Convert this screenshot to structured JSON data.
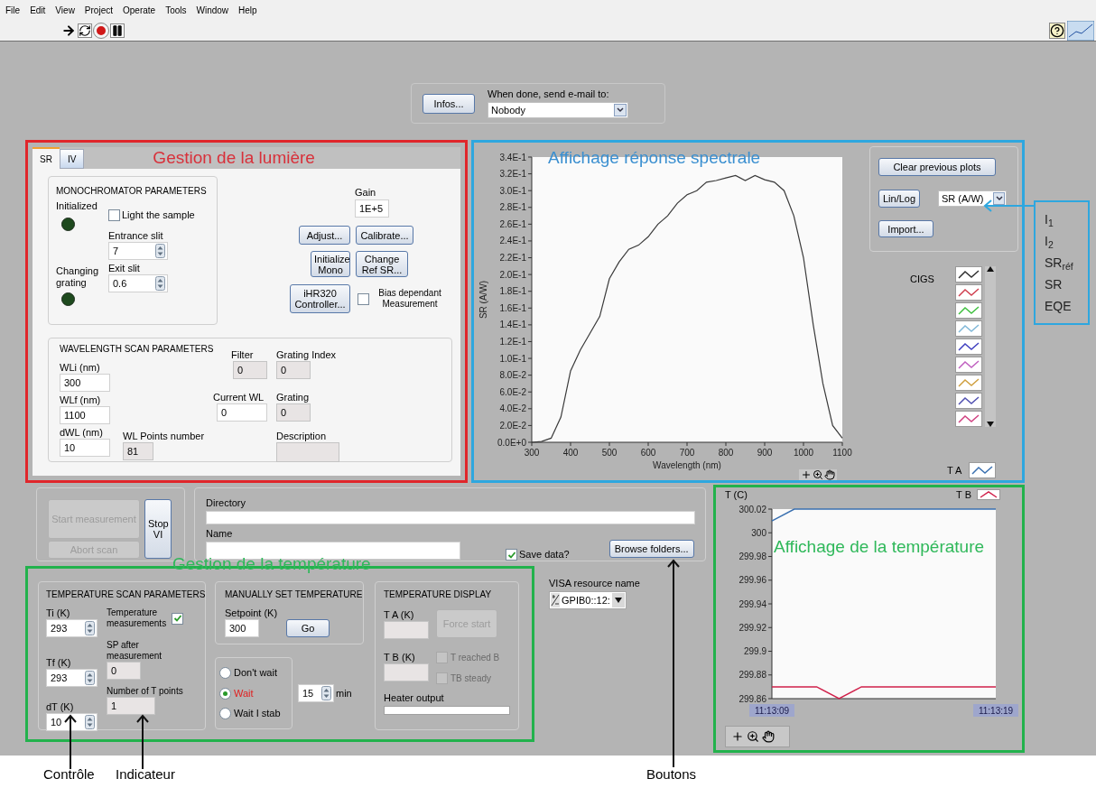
{
  "menu": [
    "File",
    "Edit",
    "View",
    "Project",
    "Operate",
    "Tools",
    "Window",
    "Help"
  ],
  "email": {
    "button": "Infos...",
    "label": "When done, send e-mail to:",
    "value": "Nobody"
  },
  "light": {
    "title": "Gestion de la lumière",
    "tabs": [
      {
        "label": "SR",
        "selected": true
      },
      {
        "label": "IV",
        "selected": false
      }
    ],
    "mono": {
      "title": "MONOCHROMATOR PARAMETERS",
      "initialized": {
        "label": "Initialized",
        "on": false
      },
      "light_sample": {
        "label": "Light the sample",
        "checked": false
      },
      "entrance": {
        "label": "Entrance slit",
        "value": "7"
      },
      "exit": {
        "label": "Exit slit",
        "value": "0.6"
      },
      "changing": {
        "label": "Changing grating",
        "on": false
      }
    },
    "gain": {
      "label": "Gain",
      "value": "1E+5"
    },
    "buttons": [
      "Adjust...",
      "Calibrate...",
      "Initialize Mono",
      "Change Ref SR...",
      "iHR320 Controller..."
    ],
    "bias": {
      "label": "Bias dependant Measurement",
      "checked": false
    },
    "scan": {
      "title": "WAVELENGTH SCAN PARAMETERS",
      "wli": {
        "label": "WLi (nm)",
        "value": "300"
      },
      "wlf": {
        "label": "WLf (nm)",
        "value": "1100"
      },
      "dwl": {
        "label": "dWL (nm)",
        "value": "10"
      },
      "points": {
        "label": "WL Points number",
        "value": "81"
      },
      "filter": {
        "label": "Filter",
        "value": "0"
      },
      "current": {
        "label": "Current WL",
        "value": "0"
      },
      "grating_index": {
        "label": "Grating Index",
        "value": "0"
      },
      "grating": {
        "label": "Grating",
        "value": "0"
      },
      "description": {
        "label": "Description"
      }
    }
  },
  "spectral": {
    "title": "Affichage réponse spectrale",
    "chart_data": {
      "type": "line",
      "xlabel": "Wavelength (nm)",
      "ylabel": "SR (A/W)",
      "xlim": [
        300,
        1100
      ],
      "ylim": [
        0,
        0.34
      ],
      "x": [
        300,
        325,
        350,
        375,
        400,
        425,
        450,
        475,
        500,
        525,
        550,
        575,
        600,
        625,
        650,
        675,
        700,
        725,
        750,
        775,
        800,
        825,
        850,
        875,
        900,
        925,
        950,
        975,
        1000,
        1025,
        1050,
        1075,
        1100
      ],
      "series": [
        {
          "name": "CIGS",
          "color": "#3a3a3a",
          "values": [
            0,
            0.001,
            0.005,
            0.03,
            0.085,
            0.11,
            0.13,
            0.15,
            0.195,
            0.215,
            0.23,
            0.235,
            0.245,
            0.26,
            0.27,
            0.285,
            0.295,
            0.3,
            0.31,
            0.312,
            0.315,
            0.318,
            0.312,
            0.318,
            0.313,
            0.31,
            0.3,
            0.27,
            0.22,
            0.14,
            0.07,
            0.02,
            0.005
          ]
        }
      ],
      "xticks": [
        300,
        400,
        500,
        600,
        700,
        800,
        900,
        1000,
        1100
      ],
      "yticks": [
        {
          "value": 0,
          "label": "0.0E+0"
        },
        {
          "value": 0.02,
          "label": "2.0E-2"
        },
        {
          "value": 0.04,
          "label": "4.0E-2"
        },
        {
          "value": 0.06,
          "label": "6.0E-2"
        },
        {
          "value": 0.08,
          "label": "8.0E-2"
        },
        {
          "value": 0.1,
          "label": "1.0E-1"
        },
        {
          "value": 0.12,
          "label": "1.2E-1"
        },
        {
          "value": 0.14,
          "label": "1.4E-1"
        },
        {
          "value": 0.16,
          "label": "1.6E-1"
        },
        {
          "value": 0.18,
          "label": "1.8E-1"
        },
        {
          "value": 0.2,
          "label": "2.0E-1"
        },
        {
          "value": 0.22,
          "label": "2.2E-1"
        },
        {
          "value": 0.24,
          "label": "2.4E-1"
        },
        {
          "value": 0.26,
          "label": "2.6E-1"
        },
        {
          "value": 0.28,
          "label": "2.8E-1"
        },
        {
          "value": 0.3,
          "label": "3.0E-1"
        },
        {
          "value": 0.32,
          "label": "3.2E-1"
        },
        {
          "value": 0.34,
          "label": "3.4E-1"
        }
      ]
    },
    "buttons": {
      "clear": "Clear previous plots",
      "linlog": "Lin/Log",
      "import": "Import..."
    },
    "unit": "SR (A/W)",
    "legend": {
      "plots": [
        {
          "color": "#303030"
        },
        {
          "color": "#d04050"
        },
        {
          "color": "#40c040"
        },
        {
          "color": "#80b8d8"
        },
        {
          "color": "#4040c0"
        },
        {
          "color": "#c060c0"
        },
        {
          "color": "#d0a040"
        },
        {
          "color": "#5050b0"
        },
        {
          "color": "#d04080"
        }
      ]
    }
  },
  "quantities": [
    "I$_{1}$",
    "I$_{2}$",
    "SR$_{réf}$",
    "SR",
    "EQE"
  ],
  "run": {
    "start": {
      "label": "Start measurement",
      "disabled": true
    },
    "abort": {
      "label": "Abort scan",
      "disabled": true
    },
    "stop": {
      "label": "Stop VI",
      "disabled": false
    }
  },
  "files": {
    "directory": {
      "label": "Directory"
    },
    "name": {
      "label": "Name"
    },
    "save": {
      "label": "Save data?",
      "checked": true
    },
    "browse": "Browse folders..."
  },
  "temperature": {
    "title": "Gestion de la température",
    "scan": {
      "title": "TEMPERATURE SCAN PARAMETERS",
      "ti": {
        "label": "Ti (K)",
        "value": "293"
      },
      "tf": {
        "label": "Tf (K)",
        "value": "293"
      },
      "dt": {
        "label": "dT (K)",
        "value": "10"
      },
      "measure": {
        "label": "Temperature measurements",
        "checked": true
      },
      "sp_after": {
        "label": "SP after measurement",
        "value": "0"
      },
      "points": {
        "label": "Number of T points",
        "value": "1"
      }
    },
    "manual": {
      "title": "MANUALLY SET TEMPERATURE",
      "setpoint": {
        "label": "Setpoint (K)",
        "value": "300"
      },
      "go": "Go"
    },
    "wait": [
      {
        "label": "Don't wait",
        "selected": false
      },
      {
        "label": "Wait",
        "selected": true
      },
      {
        "label": "Wait I stab",
        "selected": false
      }
    ],
    "wait_time": {
      "value": "15",
      "unit": "min"
    },
    "display": {
      "title": "TEMPERATURE DISPLAY",
      "ta": {
        "label": "T A (K)"
      },
      "tb": {
        "label": "T B (K)"
      },
      "force": {
        "label": "Force start",
        "disabled": true
      },
      "reached": {
        "label": "T reached B",
        "checked": false,
        "disabled": true
      },
      "steady": {
        "label": "TB steady",
        "checked": false,
        "disabled": true
      },
      "heater": {
        "label": "Heater output",
        "level": 0
      }
    }
  },
  "visa": {
    "label": "VISA resource name",
    "value": "GPIB0::12:"
  },
  "temp_chart": {
    "title": "Affichage de la température",
    "chart_data": {
      "type": "line",
      "ylabel": "T (C)",
      "categories": [
        "11:13:09",
        null,
        null,
        null,
        null,
        null,
        null,
        null,
        null,
        null,
        "11:13:19"
      ],
      "ylim": [
        299.86,
        300.02
      ],
      "yticks": [
        299.86,
        299.88,
        299.9,
        299.92,
        299.94,
        299.96,
        299.98,
        300,
        300.02
      ],
      "series": [
        {
          "name": "T A",
          "color": "#3a70b0",
          "values": [
            300.01,
            300.02,
            300.02,
            300.02,
            300.02,
            300.02,
            300.02,
            300.02,
            300.02,
            300.02,
            300.02
          ]
        },
        {
          "name": "T B",
          "color": "#d0204a",
          "values": [
            299.87,
            299.87,
            299.87,
            299.86,
            299.87,
            299.87,
            299.87,
            299.87,
            299.87,
            299.87,
            299.87
          ]
        }
      ]
    }
  },
  "callouts": {
    "control": "Contrôle",
    "indicator": "Indicateur",
    "buttons": "Boutons"
  }
}
